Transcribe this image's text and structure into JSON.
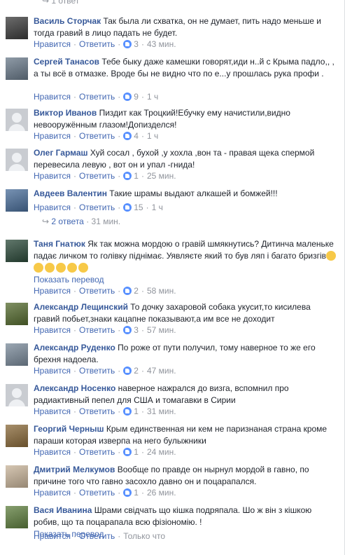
{
  "top_reply_hint": "1 ответ",
  "like_label": "Нравится",
  "reply_label": "Ответить",
  "separator": "·",
  "comments": [
    {
      "name": "Василь Сторчак",
      "text": "Так была ли схватка, он не думает, пить надо меньше и тогда гравий в лицо падать не будет.",
      "likes": "3",
      "time": "43 мин."
    },
    {
      "name": "Сергей Танасов",
      "text": "Тебе быку даже камешки говорят,иди н..й с Крыма падло,, , а ты всё в отмазке. Вроде бы не видно что по е...у прошлась рука профи .",
      "likes": "9",
      "time": "1 ч"
    },
    {
      "name": "Виктор Иванов",
      "text": "Пиздит как Троцкий!Ебучку ему начистили,видно невооружённым глазом!Допизделся!",
      "likes": "4",
      "time": "1 ч"
    },
    {
      "name": "Олег Гармаш",
      "text": "Хуй сосал , бухой ,у хохла ,вон та - правая щека спермой перевесила левую , вот он и упал -гнида!",
      "likes": "1",
      "time": "25 мин."
    },
    {
      "name": "Авдеев Валентин",
      "text": "Такие шрамы выдают алкашей и бомжей!!!",
      "likes": "15",
      "time": "1 ч",
      "replies": "2 ответа",
      "replies_time": "31 мин."
    },
    {
      "name": "Таня Гнатюк",
      "text": "Як так можна мордою о гравій шмякнутись? Дитинча маленьке падає личком то голівку піднімає. Уявляєте який то був ляп і багато бризгів",
      "emoji_count": 6,
      "translate": "Показать перевод",
      "likes": "2",
      "time": "58 мин."
    },
    {
      "name": "Александр Лещинский",
      "text": "То дочку захаровой собака укусит,то кисилева гравий побьет,знаки кацапне показывают,а им все не доходит",
      "likes": "3",
      "time": "57 мин."
    },
    {
      "name": "Александр Руденко",
      "text": "По роже от пути получил, тому наверное то же его брехня надоела.",
      "likes": "2",
      "time": "47 мин."
    },
    {
      "name": "Александр Носенко",
      "text": "наверное нажрался до визга, вспомнил про радиактивный пепел для США и томагавки в Сирии",
      "likes": "1",
      "time": "31 мин."
    },
    {
      "name": "Георгий Черныш",
      "text": "Крым единственная ни кем не паризнаная страна кроме параши которая изверпа на него булыжники",
      "likes": "1",
      "time": "24 мин."
    },
    {
      "name": "Дмитрий Мелкумов",
      "text": "Вообще по правде он нырнул мордой в гавно, по причине того что гавно засохло давно он и поцарапался.",
      "likes": "1",
      "time": "26 мин."
    },
    {
      "name": "Вася Иванина",
      "text": "Шрами свідчать що кішка подряпала. Шо ж він з кішкою робив, що та поцарапала всю фізіономію. !",
      "translate": "Показать перевод",
      "only_now": "Только что"
    }
  ],
  "colors": {
    "link": "#4267b2",
    "name": "#365899",
    "meta": "#90949c",
    "like": "#5890ff"
  }
}
